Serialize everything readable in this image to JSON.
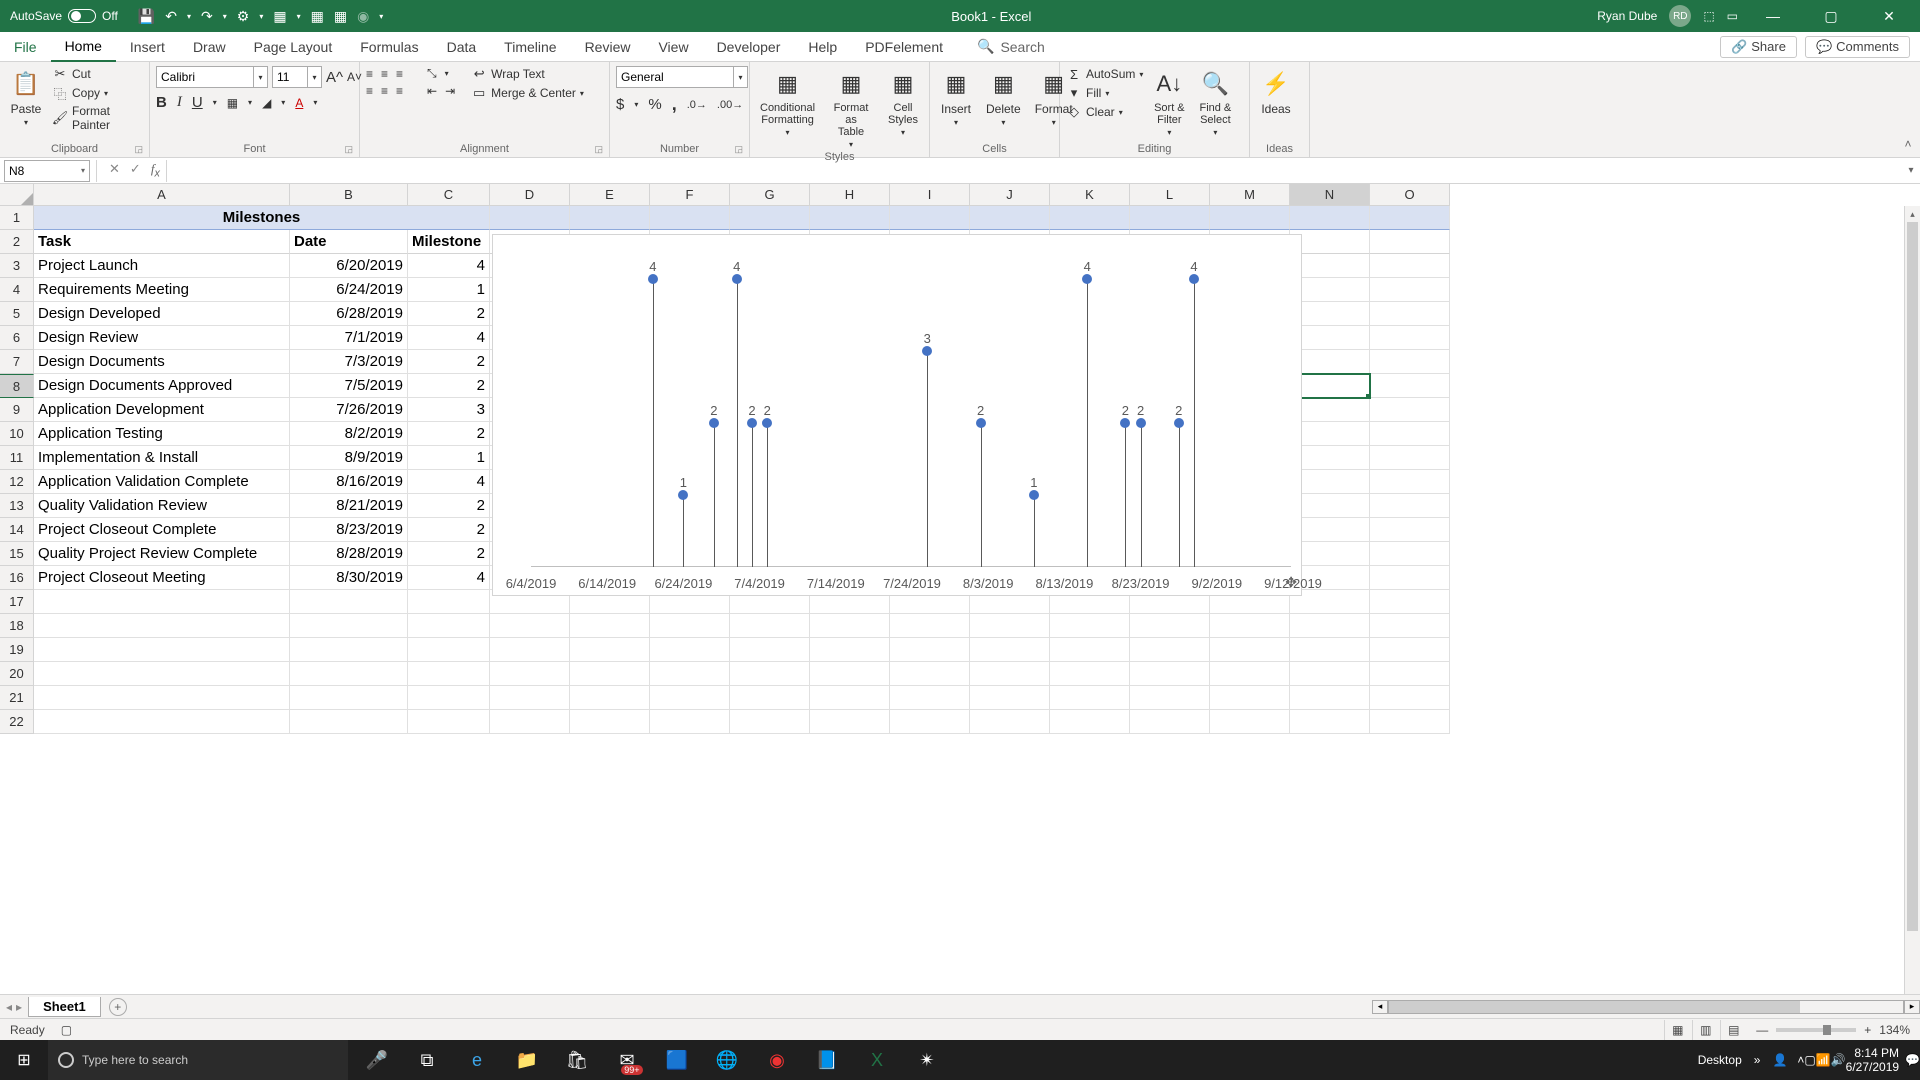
{
  "titlebar": {
    "autosave_label": "AutoSave",
    "autosave_state": "Off",
    "doc_title": "Book1  -  Excel",
    "user_name": "Ryan Dube",
    "user_initials": "RD"
  },
  "tabs": {
    "file": "File",
    "home": "Home",
    "insert": "Insert",
    "draw": "Draw",
    "page_layout": "Page Layout",
    "formulas": "Formulas",
    "data": "Data",
    "timeline": "Timeline",
    "review": "Review",
    "view": "View",
    "developer": "Developer",
    "help": "Help",
    "pdfelement": "PDFelement",
    "search_placeholder": "Search",
    "share": "Share",
    "comments": "Comments"
  },
  "ribbon": {
    "clipboard": {
      "paste": "Paste",
      "cut": "Cut",
      "copy": "Copy",
      "format_painter": "Format Painter",
      "label": "Clipboard"
    },
    "font": {
      "name": "Calibri",
      "size": "11",
      "label": "Font"
    },
    "alignment": {
      "wrap": "Wrap Text",
      "merge": "Merge & Center",
      "label": "Alignment"
    },
    "number": {
      "format": "General",
      "label": "Number"
    },
    "styles": {
      "cond": "Conditional Formatting",
      "table": "Format as Table",
      "cell": "Cell Styles",
      "label": "Styles"
    },
    "cells": {
      "insert": "Insert",
      "delete": "Delete",
      "format": "Format",
      "label": "Cells"
    },
    "editing": {
      "autosum": "AutoSum",
      "fill": "Fill",
      "clear": "Clear",
      "sort": "Sort & Filter",
      "find": "Find & Select",
      "label": "Editing"
    },
    "ideas": {
      "ideas": "Ideas",
      "label": "Ideas"
    }
  },
  "namebox": "N8",
  "columns": [
    "A",
    "B",
    "C",
    "D",
    "E",
    "F",
    "G",
    "H",
    "I",
    "J",
    "K",
    "L",
    "M",
    "N",
    "O"
  ],
  "selected_col": "N",
  "selected_row": 8,
  "sheet": {
    "title": "Milestones",
    "headers": {
      "task": "Task",
      "date": "Date",
      "milestone": "Milestone"
    },
    "rows": [
      {
        "task": "Project Launch",
        "date": "6/20/2019",
        "milestone": 4
      },
      {
        "task": "Requirements Meeting",
        "date": "6/24/2019",
        "milestone": 1
      },
      {
        "task": "Design Developed",
        "date": "6/28/2019",
        "milestone": 2
      },
      {
        "task": "Design Review",
        "date": "7/1/2019",
        "milestone": 4
      },
      {
        "task": "Design Documents",
        "date": "7/3/2019",
        "milestone": 2
      },
      {
        "task": "Design Documents Approved",
        "date": "7/5/2019",
        "milestone": 2
      },
      {
        "task": "Application Development",
        "date": "7/26/2019",
        "milestone": 3
      },
      {
        "task": "Application Testing",
        "date": "8/2/2019",
        "milestone": 2
      },
      {
        "task": "Implementation & Install",
        "date": "8/9/2019",
        "milestone": 1
      },
      {
        "task": "Application Validation Complete",
        "date": "8/16/2019",
        "milestone": 4
      },
      {
        "task": "Quality Validation Review",
        "date": "8/21/2019",
        "milestone": 2
      },
      {
        "task": "Project Closeout Complete",
        "date": "8/23/2019",
        "milestone": 2
      },
      {
        "task": "Quality Project Review Complete",
        "date": "8/28/2019",
        "milestone": 2
      },
      {
        "task": "Project Closeout Meeting",
        "date": "8/30/2019",
        "milestone": 4
      }
    ]
  },
  "chart_data": {
    "type": "scatter",
    "x_labels": [
      "6/4/2019",
      "6/14/2019",
      "6/24/2019",
      "7/4/2019",
      "7/14/2019",
      "7/24/2019",
      "8/3/2019",
      "8/13/2019",
      "8/23/2019",
      "9/2/2019",
      "9/12/2019"
    ],
    "ylim": [
      0,
      4.5
    ],
    "series": [
      {
        "name": "Milestone",
        "points": [
          {
            "x": "6/20/2019",
            "y": 4
          },
          {
            "x": "6/24/2019",
            "y": 1
          },
          {
            "x": "6/28/2019",
            "y": 2
          },
          {
            "x": "7/1/2019",
            "y": 4
          },
          {
            "x": "7/3/2019",
            "y": 2
          },
          {
            "x": "7/5/2019",
            "y": 2
          },
          {
            "x": "7/26/2019",
            "y": 3
          },
          {
            "x": "8/2/2019",
            "y": 2
          },
          {
            "x": "8/9/2019",
            "y": 1
          },
          {
            "x": "8/16/2019",
            "y": 4
          },
          {
            "x": "8/21/2019",
            "y": 2
          },
          {
            "x": "8/23/2019",
            "y": 2
          },
          {
            "x": "8/28/2019",
            "y": 2
          },
          {
            "x": "8/30/2019",
            "y": 4
          }
        ]
      }
    ]
  },
  "sheettab": "Sheet1",
  "status": {
    "ready": "Ready",
    "zoom": "134%"
  },
  "taskbar": {
    "search_placeholder": "Type here to search",
    "desktop": "Desktop",
    "time": "8:14 PM",
    "date": "6/27/2019",
    "mail_badge": "99+"
  }
}
